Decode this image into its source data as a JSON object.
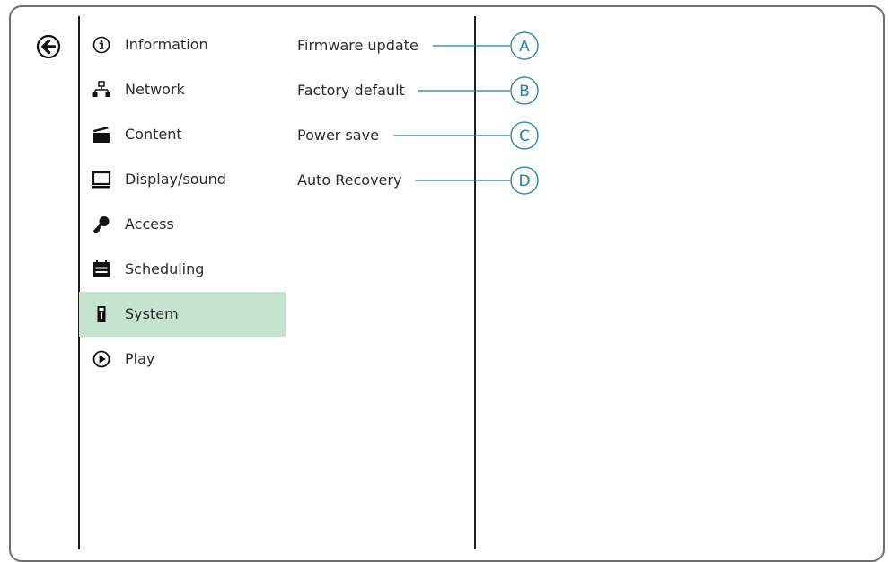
{
  "colors": {
    "selected_background": "#c5e3cf",
    "callout": "#1d7ea8",
    "divider": "#1e1e1e",
    "frame": "#6e6e6e"
  },
  "back_button": {
    "icon": "arrow-left-circle-icon"
  },
  "menu": {
    "selected": "System",
    "items": [
      {
        "label": "Information",
        "icon": "info-circle-icon"
      },
      {
        "label": "Network",
        "icon": "network-icon"
      },
      {
        "label": "Content",
        "icon": "clapperboard-icon"
      },
      {
        "label": "Display/sound",
        "icon": "monitor-icon"
      },
      {
        "label": "Access",
        "icon": "key-icon"
      },
      {
        "label": "Scheduling",
        "icon": "calendar-icon"
      },
      {
        "label": "System",
        "icon": "system-device-icon"
      },
      {
        "label": "Play",
        "icon": "play-circle-icon"
      }
    ]
  },
  "submenu": {
    "items": [
      {
        "label": "Firmware update",
        "callout": "A"
      },
      {
        "label": "Factory default",
        "callout": "B"
      },
      {
        "label": "Power save",
        "callout": "C"
      },
      {
        "label": "Auto Recovery",
        "callout": "D"
      }
    ]
  }
}
